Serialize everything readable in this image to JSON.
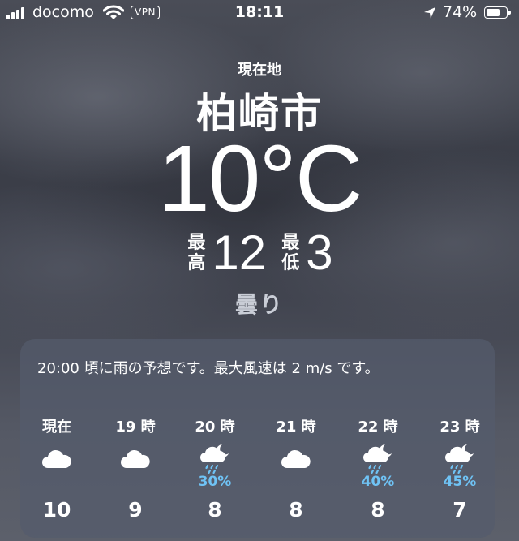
{
  "status_bar": {
    "carrier": "docomo",
    "vpn": "VPN",
    "time": "18:11",
    "battery": "74%",
    "battery_level": 0.74,
    "icons": [
      "signal-icon",
      "wifi-icon",
      "location-arrow-icon",
      "battery-icon"
    ]
  },
  "weather": {
    "location_label": "現在地",
    "city": "柏崎市",
    "temperature": "10°C",
    "high_label": "最高",
    "high": "12",
    "low_label": "最低",
    "low": "3",
    "condition": "曇り"
  },
  "forecast": {
    "summary": "20:00 頃に雨の予想です。最大風速は 2 m/s です。",
    "hours": [
      {
        "label": "現在",
        "icon": "cloud-icon",
        "pop": "",
        "temp": "10"
      },
      {
        "label": "19 時",
        "icon": "cloud-icon",
        "pop": "",
        "temp": "9"
      },
      {
        "label": "20 時",
        "icon": "night-rain-icon",
        "pop": "30%",
        "temp": "8"
      },
      {
        "label": "21 時",
        "icon": "cloud-icon",
        "pop": "",
        "temp": "8"
      },
      {
        "label": "22 時",
        "icon": "night-rain-icon",
        "pop": "40%",
        "temp": "8"
      },
      {
        "label": "23 時",
        "icon": "night-rain-icon",
        "pop": "45%",
        "temp": "7"
      }
    ]
  },
  "colors": {
    "precip": "#6fc3f5",
    "card": "#545c6c"
  }
}
